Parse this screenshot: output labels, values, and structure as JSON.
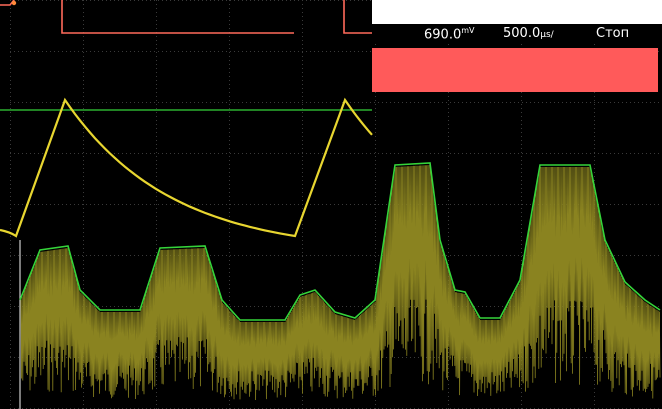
{
  "status": {
    "trigger_level": "690.0",
    "trigger_level_unit": "mV",
    "timebase": "500.0",
    "timebase_unit": "µs/",
    "run_state": "Стоп"
  },
  "colors": {
    "background": "#000000",
    "grid": "#3a3a3a",
    "channel_yellow": "#e8d630",
    "channel_yellow_dim": "#8a8320",
    "channel_green": "#35d43a",
    "pulse_red": "#ff6a5a",
    "banner_red": "#ff5a5a",
    "text": "#ffffff"
  }
}
